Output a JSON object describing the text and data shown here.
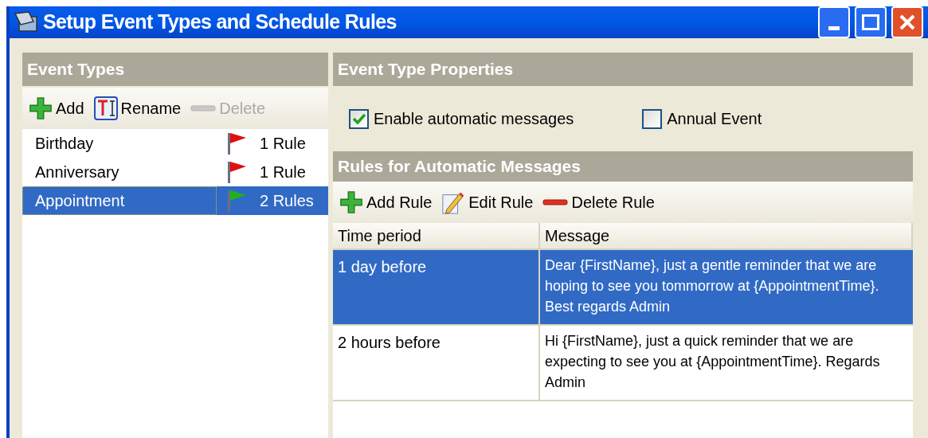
{
  "window": {
    "title": "Setup Event Types and Schedule Rules"
  },
  "event_types": {
    "header": "Event Types",
    "toolbar": [
      {
        "label": "Add",
        "kind": "add",
        "disabled": false
      },
      {
        "label": "Rename",
        "kind": "rename",
        "disabled": false
      },
      {
        "label": "Delete",
        "kind": "delete",
        "disabled": true
      }
    ],
    "items": [
      {
        "name": "Birthday",
        "rules": "1 Rule",
        "color": "#e01010",
        "selected": false
      },
      {
        "name": "Anniversary",
        "rules": "1 Rule",
        "color": "#e01010",
        "selected": false
      },
      {
        "name": "Appointment",
        "rules": "2 Rules",
        "color": "#20b020",
        "selected": true
      }
    ]
  },
  "properties": {
    "header": "Event Type Properties",
    "options": [
      {
        "label": "Enable automatic messages",
        "checked": true
      },
      {
        "label": "Annual Event",
        "checked": false
      }
    ]
  },
  "rules": {
    "header": "Rules for Automatic Messages",
    "toolbar": [
      {
        "label": "Add Rule",
        "kind": "add"
      },
      {
        "label": "Edit Rule",
        "kind": "edit"
      },
      {
        "label": "Delete Rule",
        "kind": "delete"
      }
    ],
    "columns": [
      "Time period",
      "Message"
    ],
    "rows": [
      {
        "time_period": "1 day before",
        "message": "Dear {FirstName}, just a gentle reminder that we are hoping to see you tommorrow at {AppointmentTime}. Best regards Admin",
        "selected": true
      },
      {
        "time_period": "2 hours before",
        "message": "Hi {FirstName}, just a quick reminder that we are expecting to see you at {AppointmentTime}. Regards Admin",
        "selected": false
      }
    ]
  }
}
